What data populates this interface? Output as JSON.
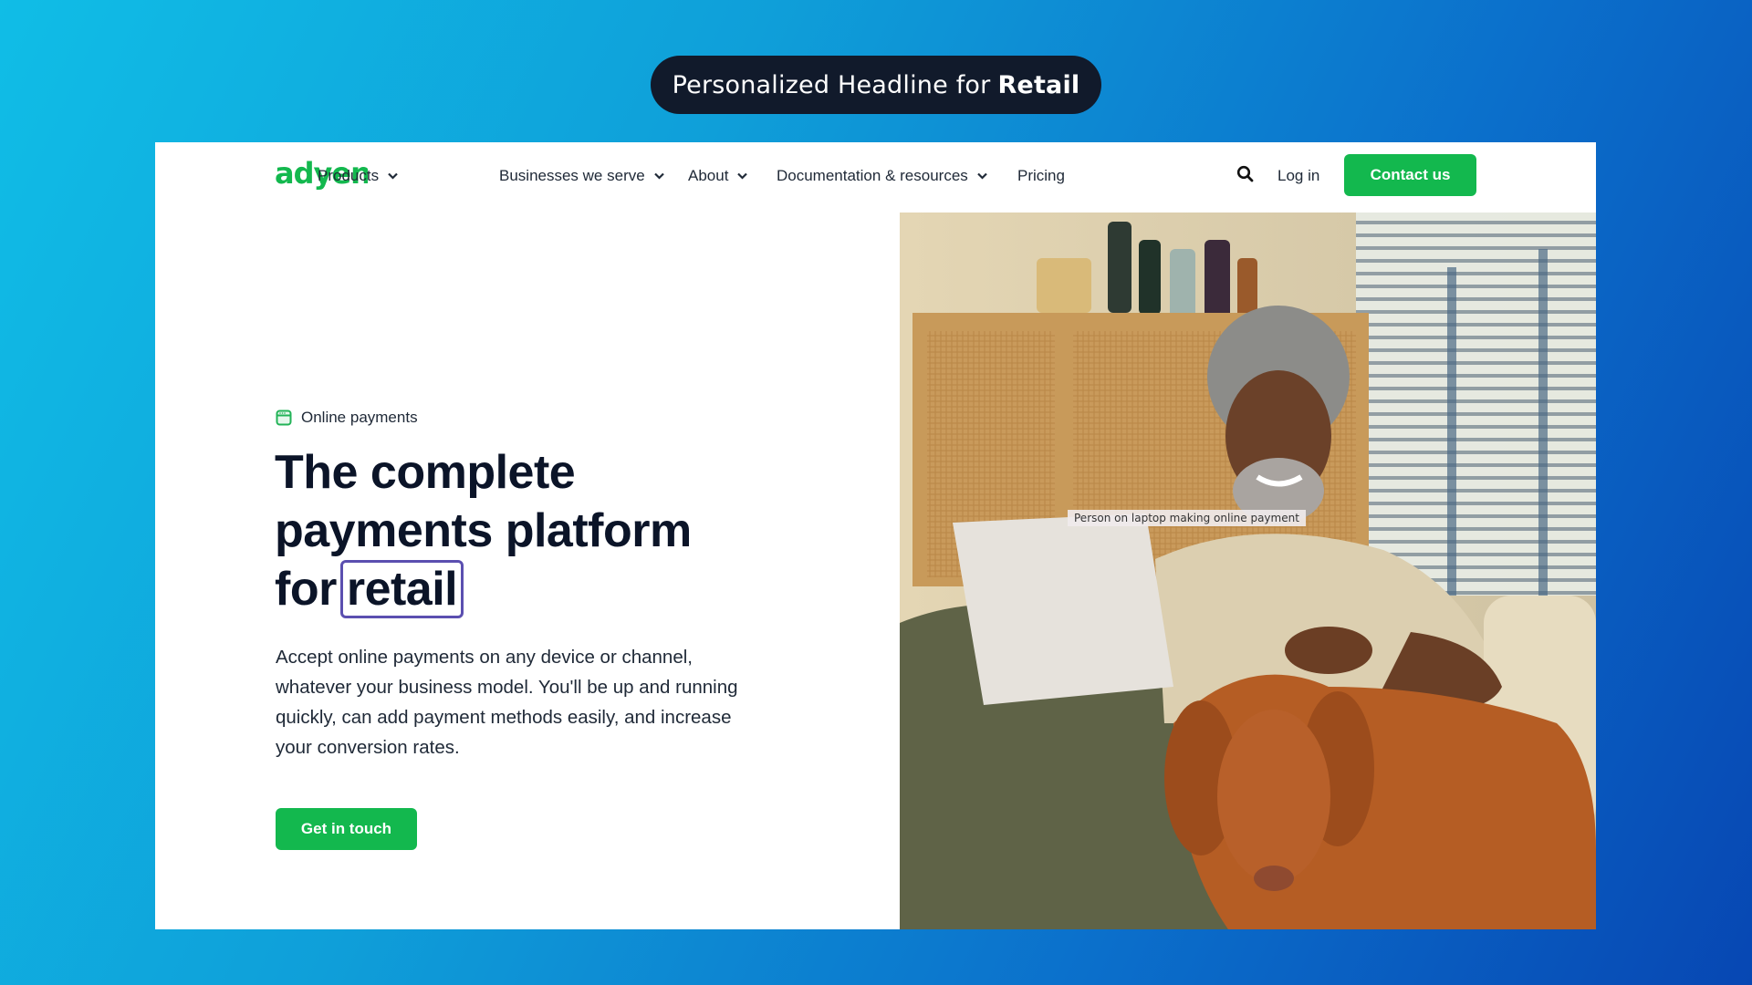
{
  "banner": {
    "prefix": "Personalized Headline for",
    "emphasis": "Retail"
  },
  "nav": {
    "logo_text": "adyen",
    "items": [
      {
        "label": "Products",
        "has_dropdown": true
      },
      {
        "label": "Businesses we serve",
        "has_dropdown": true
      },
      {
        "label": "About",
        "has_dropdown": true
      },
      {
        "label": "Documentation & resources",
        "has_dropdown": true
      },
      {
        "label": "Pricing",
        "has_dropdown": false
      }
    ],
    "search_icon": "search-icon",
    "login_label": "Log in",
    "contact_label": "Contact us"
  },
  "hero": {
    "eyebrow_icon": "browser-window-icon",
    "eyebrow": "Online payments",
    "headline_lines": [
      "The complete",
      "payments platform",
      "for"
    ],
    "headline_highlight": "retail",
    "description": "Accept online payments on any device or channel, whatever your business model. You'll be up and running quickly, can add payment methods easily, and increase your conversion rates.",
    "cta_label": "Get in touch",
    "image_alt_tooltip": "Person on laptop making online payment"
  },
  "colors": {
    "brand_green": "#13b84e",
    "headline": "#0b1428",
    "highlight_border": "#5b4fb0",
    "banner_bg": "#111a2b"
  }
}
